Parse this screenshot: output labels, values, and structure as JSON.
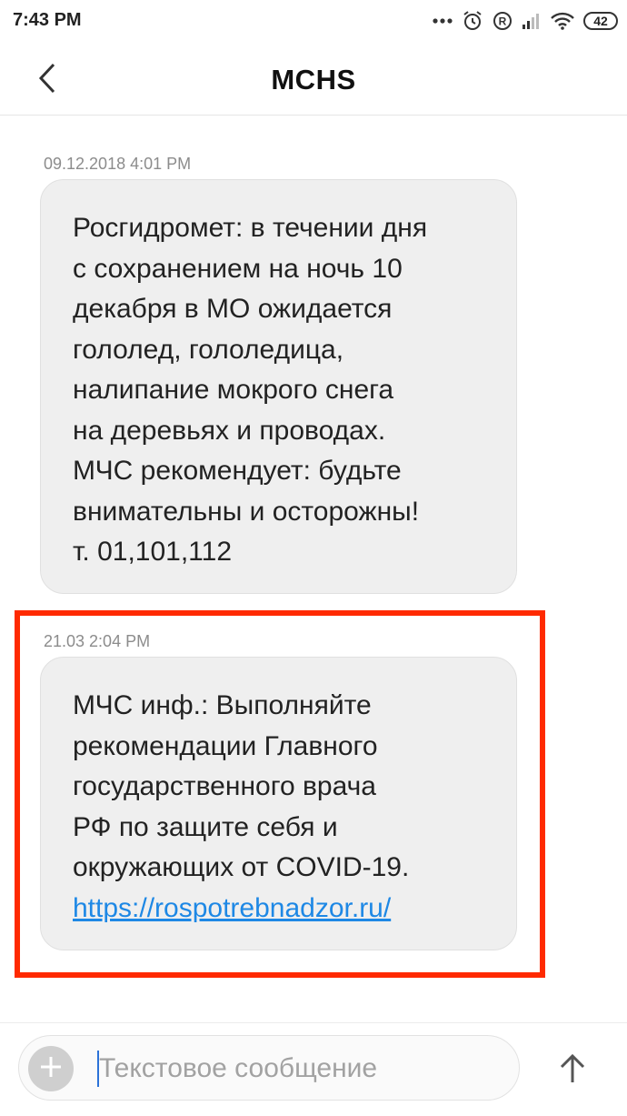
{
  "status_bar": {
    "time": "7:43 PM",
    "battery": "42",
    "icons": [
      "more-dots-icon",
      "alarm-icon",
      "registered-icon",
      "signal-icon",
      "wifi-icon",
      "battery-icon"
    ]
  },
  "header": {
    "title": "MCHS",
    "back_icon": "chevron-left-icon"
  },
  "messages": [
    {
      "timestamp": "09.12.2018 4:01 PM",
      "text": "Росгидромет: в течении дня\nс сохранением на ночь 10\nдекабря в МО ожидается\nгололед, гололедица,\nналипание мокрого снега\nна деревьях и проводах.\nМЧС рекомендует: будьте\nвнимательны и осторожны!\nт. 01,101,112"
    },
    {
      "timestamp": "21.03 2:04 PM",
      "text": "МЧС инф.: Выполняйте\nрекомендации Главного\nгосударственного врача\nРФ по защите себя и\nокружающих от COVID-19.",
      "link": "https://rospotrebnadzor.ru/"
    }
  ],
  "composer": {
    "placeholder": "Текстовое сообщение",
    "value": "",
    "attach_icon": "plus-icon",
    "send_icon": "arrow-up-icon"
  },
  "colors": {
    "highlight": "#ff2a00",
    "bubble": "#efefef",
    "link": "#1e88e5"
  }
}
